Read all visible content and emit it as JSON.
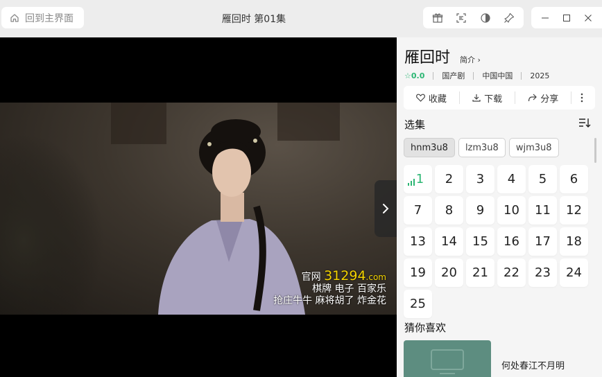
{
  "titlebar": {
    "home_label": "回到主界面",
    "title": "雁回时 第01集",
    "tools": [
      "gift-icon",
      "scan-icon",
      "contrast-icon",
      "pin-icon"
    ],
    "window_controls": [
      "minimize-icon",
      "maximize-icon",
      "close-icon"
    ]
  },
  "player": {
    "watermark": {
      "prefix": "官网",
      "number": "31294",
      "domain": ".com",
      "line2": "棋牌  电子  百家乐",
      "line3": "抢庄牛牛  麻将胡了  炸金花"
    },
    "next_icon": "chevron-right-icon"
  },
  "details": {
    "title": "雁回时",
    "intro_link": "简介 ›",
    "rating": "☆0.0",
    "genre": "国产剧",
    "region": "中国中国",
    "year": "2025",
    "actions": {
      "favorite": "收藏",
      "download": "下载",
      "share": "分享"
    }
  },
  "episodes": {
    "section_title": "选集",
    "sources": [
      "hnm3u8",
      "lzm3u8",
      "wjm3u8"
    ],
    "active_source": "hnm3u8",
    "list": [
      "1",
      "2",
      "3",
      "4",
      "5",
      "6",
      "7",
      "8",
      "9",
      "10",
      "11",
      "12",
      "13",
      "14",
      "15",
      "16",
      "17",
      "18",
      "19",
      "20",
      "21",
      "22",
      "23",
      "24",
      "25"
    ],
    "current": "1"
  },
  "recommend": {
    "section_title": "猜你喜欢",
    "items": [
      {
        "title": "何处春江不月明"
      }
    ]
  },
  "colors": {
    "accent": "#2bb673",
    "watermark": "#f5d400",
    "panel": "#f5f5f5"
  }
}
